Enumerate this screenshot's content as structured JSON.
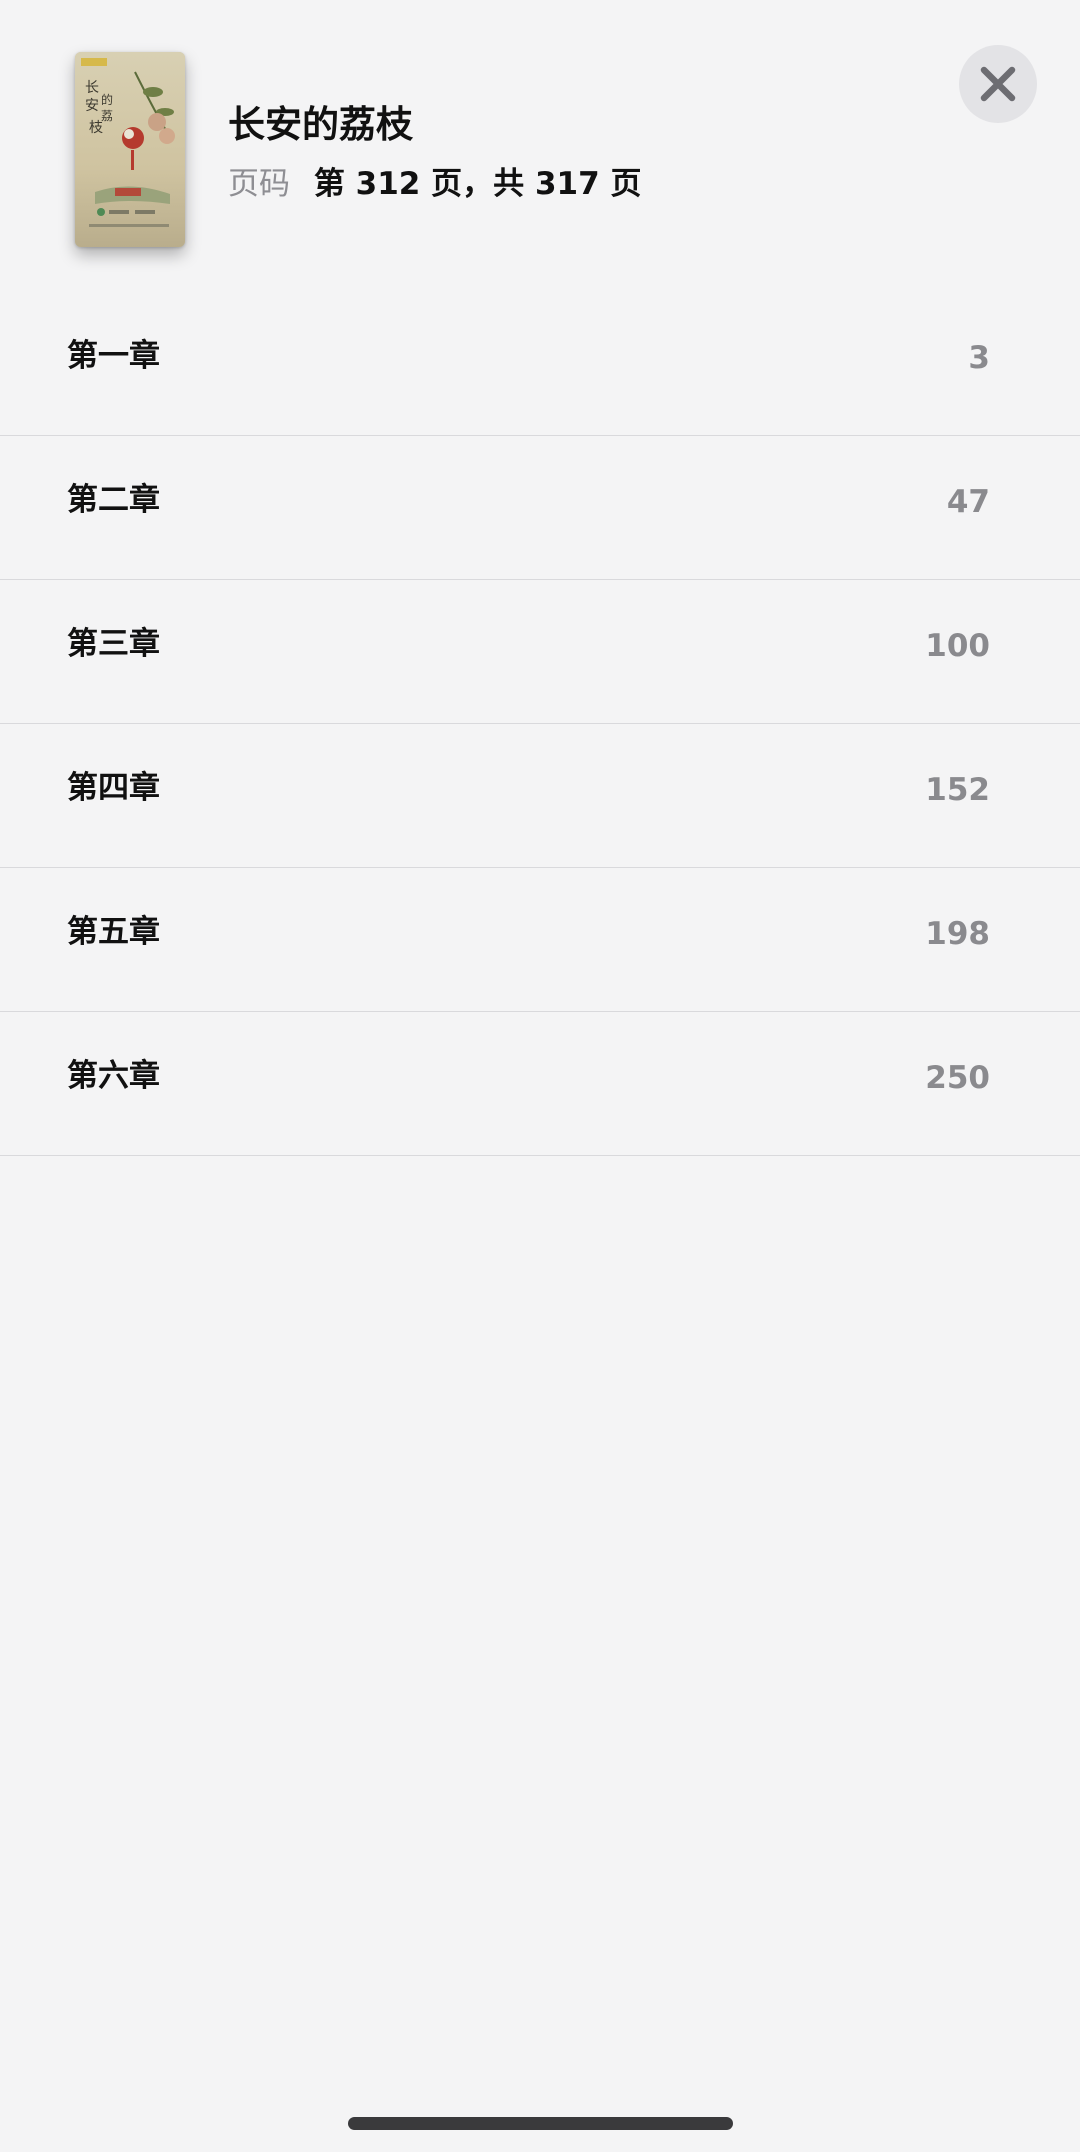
{
  "book": {
    "title": "长安的荔枝",
    "page_label": "页码",
    "page_value": "第 312 页，共 317 页",
    "cover_icon": "book-cover-image"
  },
  "close_button": {
    "icon": "close-icon"
  },
  "chapters": [
    {
      "name": "第一章",
      "page": "3"
    },
    {
      "name": "第二章",
      "page": "47"
    },
    {
      "name": "第三章",
      "page": "100"
    },
    {
      "name": "第四章",
      "page": "152"
    },
    {
      "name": "第五章",
      "page": "198"
    },
    {
      "name": "第六章",
      "page": "250"
    }
  ],
  "colors": {
    "background": "#f4f4f5",
    "text_primary": "#111111",
    "text_secondary": "#8e8e93",
    "divider": "#d9d9dc",
    "close_button_bg": "#e3e3e6"
  }
}
